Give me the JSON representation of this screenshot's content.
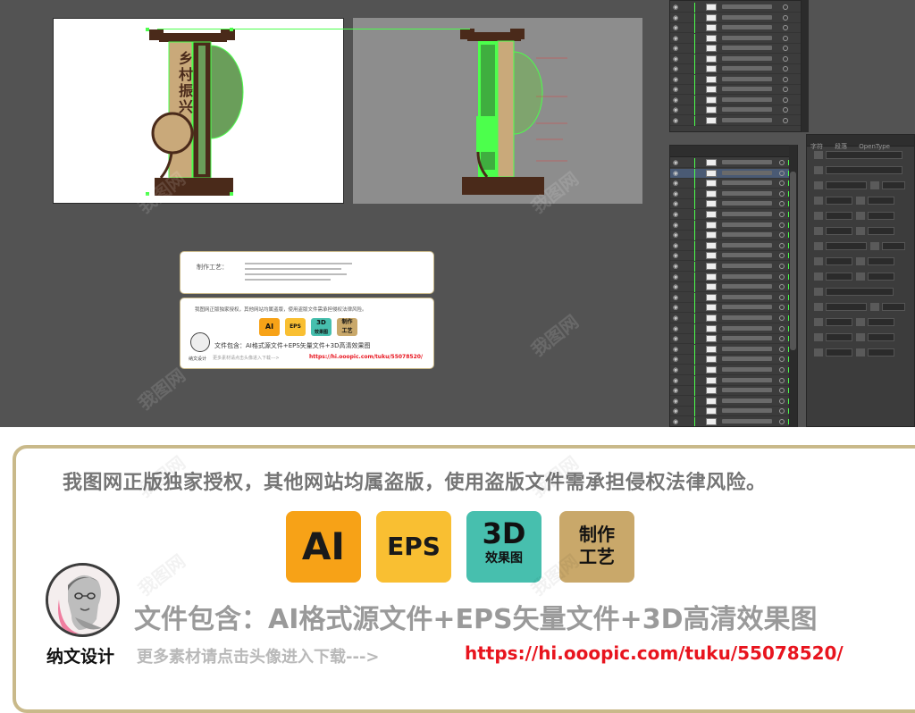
{
  "notice": "我图网正版独家授权，其他网站均属盗版，使用盗版文件需承担侵权法律风险。",
  "badges": {
    "ai": "AI",
    "eps": "EPS",
    "three_d": {
      "line1": "3D",
      "line2": "效果图"
    },
    "craft": {
      "line1": "制作",
      "line2": "工艺"
    }
  },
  "contains": "文件包含：AI格式源文件+EPS矢量文件+3D高清效果图",
  "brand": "纳文设计",
  "more": "更多素材请点击头像进入下载--->",
  "url": "https://hi.ooopic.com/tuku/55078520/",
  "design": {
    "title": "乡村振兴"
  },
  "mini": {
    "craft_title": "制作工艺：",
    "notice": "我图网正版独家授权，其他网站均属盗版，使用盗版文件需承担侵权法律风险。",
    "contains": "文件包含：AI格式源文件+EPS矢量文件+3D高清效果图",
    "brand": "纳文设计",
    "more": "更多素材请点击头像进入下载--->",
    "url": "https://hi.ooopic.com/tuku/55078520/"
  },
  "panels": {
    "char_tab": "字符",
    "para_tab": "段落",
    "opentype_tab": "OpenType"
  },
  "colors": {
    "workspace": "#535353",
    "panel": "#3c3c3c",
    "selection": "#4cff4c",
    "frame": "#c9b98a",
    "url": "#e8141e",
    "ai_badge": "#f7a217",
    "eps_badge": "#f9bf32",
    "three_d_badge": "#47bfae",
    "craft_badge": "#c9a86a",
    "sign_brown": "#4a2a1a",
    "sign_tan": "#c9a97a",
    "sign_green": "#6a9e5a"
  },
  "icons": [
    "eye-icon",
    "lock-icon",
    "avatar-statue"
  ]
}
